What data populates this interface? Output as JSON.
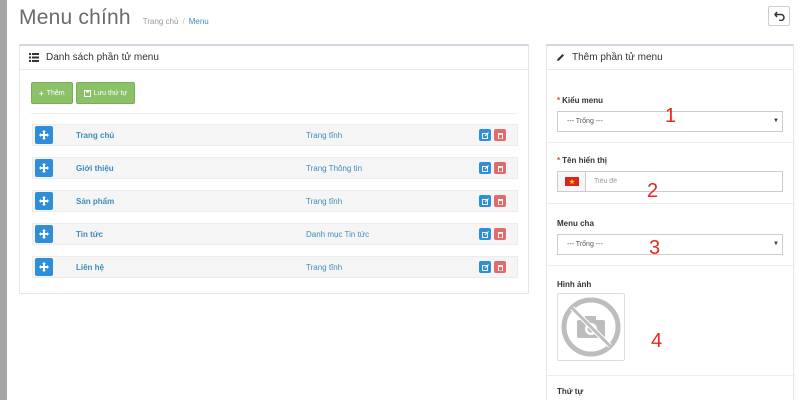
{
  "header": {
    "title": "Menu chính",
    "breadcrumb": [
      "Trang chủ",
      "Menu"
    ],
    "breadcrumb_separator": "/",
    "back_icon": "undo-arrow-icon"
  },
  "list_panel": {
    "title": "Danh sách phần tử menu",
    "title_icon": "list-icon",
    "add_button": "Thêm",
    "save_order_button": "Lưu thứ tự",
    "rows": [
      {
        "name": "Trang chủ",
        "type": "Trang tĩnh"
      },
      {
        "name": "Giới thiệu",
        "type": "Trang Thông tin"
      },
      {
        "name": "Sản phẩm",
        "type": "Trang tĩnh"
      },
      {
        "name": "Tin tức",
        "type": "Danh mục Tin tức"
      },
      {
        "name": "Liên hệ",
        "type": "Trang tĩnh"
      }
    ]
  },
  "add_panel": {
    "title": "Thêm phần tử menu",
    "title_icon": "pencil-icon",
    "menu_type": {
      "label": "Kiểu menu",
      "required_mark": "*",
      "value": "--- Trống ---"
    },
    "display_name": {
      "label": "Tên hiển thị",
      "required_mark": "*",
      "placeholder": "Tiêu đề",
      "flag": "vietnam-flag-icon"
    },
    "parent_menu": {
      "label": "Menu cha",
      "value": "--- Trống ---"
    },
    "image": {
      "label": "Hình ảnh",
      "icon": "no-camera-icon"
    },
    "order": {
      "label": "Thứ tự"
    }
  },
  "annotations": [
    "1",
    "2",
    "3",
    "4"
  ],
  "colors": {
    "accent_blue": "#2f8ed8",
    "link_blue": "#3c8dbc",
    "button_green": "#8bc169",
    "delete_red": "#e26a6a",
    "required_red": "#dd4b39",
    "annotation_red": "#e8271f"
  }
}
